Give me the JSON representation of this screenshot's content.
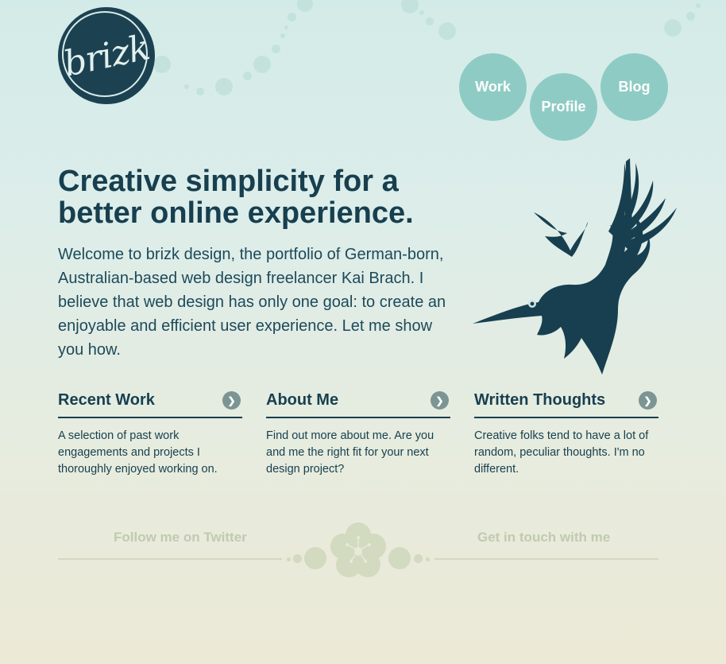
{
  "brand": {
    "logo_text": "brizk",
    "logo_color": "#1c4252",
    "accent": "#8ecbc4"
  },
  "nav": {
    "work": "Work",
    "profile": "Profile",
    "blog": "Blog"
  },
  "hero": {
    "headline": "Creative simplicity for a better online experience.",
    "intro": "Welcome to brizk design, the portfolio of German-born, Australian-based web design freelancer Kai Brach. I believe that web design has only one goal: to create an enjoyable and efficient user experience. Let me show you how."
  },
  "sections": [
    {
      "title": "Recent Work",
      "text": "A selection of past work engagements and projects I thoroughly enjoyed working on."
    },
    {
      "title": "About Me",
      "text": "Find out more about me. Are you and me the right fit for your next design project?"
    },
    {
      "title": "Written Thoughts",
      "text": "Creative folks tend to have a lot of random, peculiar thoughts. I'm no different."
    }
  ],
  "footer": {
    "twitter": "Follow me on Twitter",
    "contact": "Get in touch with me"
  },
  "icons": {
    "arrow": "chevron-right-icon",
    "bird": "hummingbird-icon",
    "flower": "flower-icon"
  }
}
